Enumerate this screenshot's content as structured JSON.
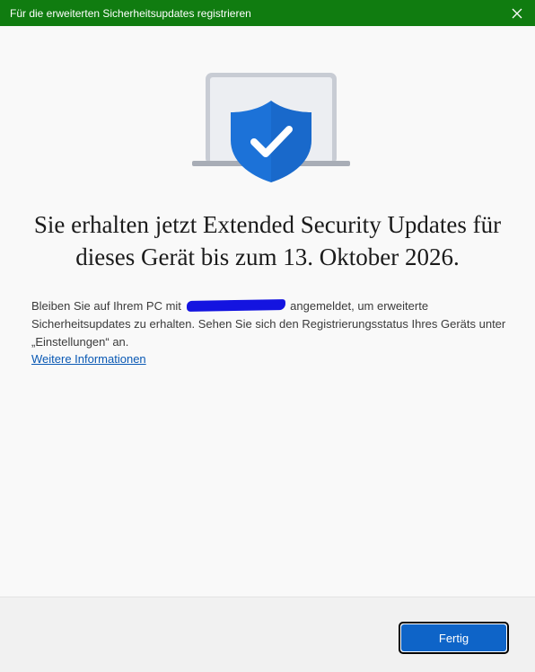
{
  "window": {
    "title": "Für die erweiterten Sicherheitsupdates registrieren",
    "close_icon": "close-icon",
    "accent_color": "#107c10"
  },
  "hero": {
    "icon": "laptop-shield-check-icon",
    "shield_color": "#1c72d8"
  },
  "main": {
    "headline": "Sie erhalten jetzt Extended Security Updates für dieses Gerät bis zum 13. Oktober 2026.",
    "body_before": "Bleiben Sie auf Ihrem PC mit",
    "body_after": "angemeldet, um erweiterte Sicherheitsupdates zu erhalten. Sehen Sie sich den Registrierungsstatus Ihres Geräts unter „Einstellungen“ an.",
    "link": "Weitere Informationen"
  },
  "footer": {
    "done_label": "Fertig",
    "button_color": "#0e64c8"
  }
}
